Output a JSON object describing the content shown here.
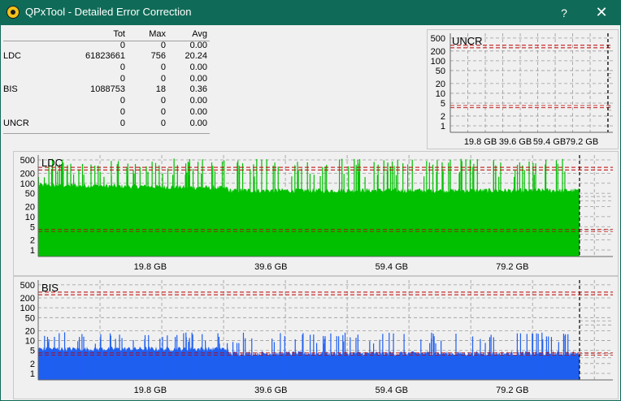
{
  "window": {
    "title": "QPxTool - Detailed Error Correction",
    "help_label": "?",
    "close_label": "✕",
    "icon": "qpxtool-app-icon"
  },
  "stats": {
    "headers": [
      "",
      "Tot",
      "Max",
      "Avg"
    ],
    "rows": [
      {
        "label": "",
        "tot": "0",
        "max": "0",
        "avg": "0.00"
      },
      {
        "label": "LDC",
        "tot": "61823661",
        "max": "756",
        "avg": "20.24"
      },
      {
        "label": "",
        "tot": "0",
        "max": "0",
        "avg": "0.00"
      },
      {
        "label": "",
        "tot": "0",
        "max": "0",
        "avg": "0.00"
      },
      {
        "label": "BIS",
        "tot": "1088753",
        "max": "18",
        "avg": "0.36"
      },
      {
        "label": "",
        "tot": "0",
        "max": "0",
        "avg": "0.00"
      },
      {
        "label": "",
        "tot": "0",
        "max": "0",
        "avg": "0.00"
      },
      {
        "label": "UNCR",
        "tot": "0",
        "max": "0",
        "avg": "0.00"
      }
    ]
  },
  "colors": {
    "titlebar": "#0f6b57",
    "ldc": "#00c000",
    "bis": "#1f5ff0",
    "red_threshold": "#c00000"
  },
  "chart_data": [
    {
      "type": "area",
      "id": "uncr",
      "title": "UNCR",
      "scale": "log",
      "yticks": [
        "500",
        "200",
        "100",
        "50",
        "20",
        "10",
        "5",
        "2",
        "1"
      ],
      "xticks": [
        "19.8 GB",
        "39.6 GB",
        "59.4 GB",
        "79.2 GB"
      ],
      "series": [
        {
          "values": []
        }
      ]
    },
    {
      "type": "area",
      "id": "ldc",
      "title": "LDC",
      "scale": "log",
      "yticks": [
        "500",
        "200",
        "100",
        "50",
        "20",
        "10",
        "5",
        "2",
        "1"
      ],
      "xticks": [
        "19.8 GB",
        "39.6 GB",
        "59.4 GB",
        "79.2 GB"
      ],
      "series": [
        {
          "baseline": 80,
          "spike_max": 756
        }
      ]
    },
    {
      "type": "area",
      "id": "bis",
      "title": "BIS",
      "scale": "log",
      "yticks": [
        "500",
        "200",
        "100",
        "50",
        "20",
        "10",
        "5",
        "2",
        "1"
      ],
      "xticks": [
        "19.8 GB",
        "39.6 GB",
        "59.4 GB",
        "79.2 GB"
      ],
      "series": [
        {
          "baseline": 5,
          "spike_max": 18
        }
      ]
    }
  ]
}
